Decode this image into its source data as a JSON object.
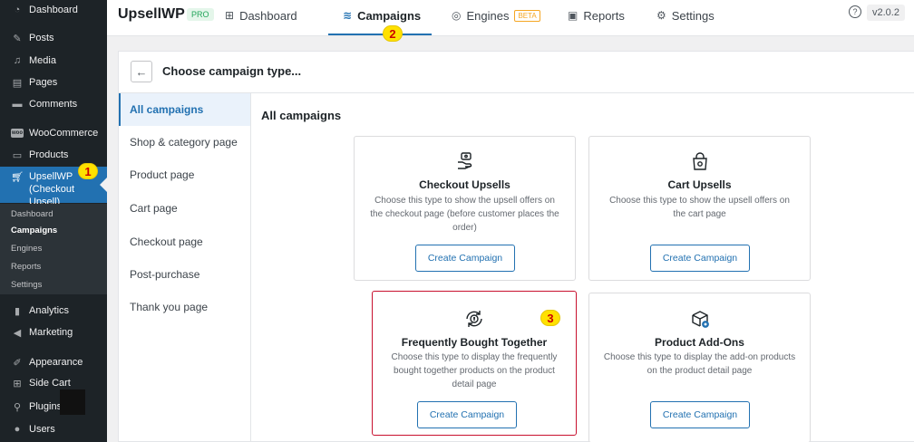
{
  "sidebar": {
    "items": [
      {
        "label": "Dashboard",
        "icon": "dashboard-icon"
      },
      {
        "label": "Posts",
        "icon": "pin-icon"
      },
      {
        "label": "Media",
        "icon": "media-icon"
      },
      {
        "label": "Pages",
        "icon": "page-icon"
      },
      {
        "label": "Comments",
        "icon": "comment-icon"
      },
      {
        "label": "WooCommerce",
        "icon": "woo-icon"
      },
      {
        "label": "Products",
        "icon": "archive-icon"
      },
      {
        "label": "Analytics",
        "icon": "bar-chart-icon"
      },
      {
        "label": "Marketing",
        "icon": "megaphone-icon"
      },
      {
        "label": "Appearance",
        "icon": "brush-icon"
      },
      {
        "label": "Side Cart",
        "icon": "cart-icon"
      },
      {
        "label": "Plugins",
        "icon": "plug-icon"
      },
      {
        "label": "Users",
        "icon": "user-icon"
      }
    ],
    "active": {
      "line1": "UpsellWP",
      "line2": "(Checkout Upsell)"
    },
    "submenu": [
      "Dashboard",
      "Campaigns",
      "Engines",
      "Reports",
      "Settings"
    ],
    "submenu_current": "Campaigns",
    "woo_badge": "woo"
  },
  "badges": {
    "one": "1",
    "two": "2",
    "three": "3"
  },
  "topbar": {
    "brand": "UpsellWP",
    "pro": "PRO",
    "tabs": [
      {
        "label": "Dashboard"
      },
      {
        "label": "Campaigns"
      },
      {
        "label": "Engines",
        "badge": "BETA"
      },
      {
        "label": "Reports"
      },
      {
        "label": "Settings"
      }
    ],
    "help": "?",
    "version": "v2.0.2"
  },
  "panel": {
    "title": "Choose campaign type...",
    "back": "←",
    "section_title": "All campaigns"
  },
  "categories": [
    "All campaigns",
    "Shop & category page",
    "Product page",
    "Cart page",
    "Checkout page",
    "Post-purchase",
    "Thank you page"
  ],
  "cards": [
    {
      "title": "Checkout Upsells",
      "desc": "Choose this type to show the upsell offers on the checkout page (before customer places the order)",
      "button": "Create Campaign",
      "icon": "hand-coin-icon"
    },
    {
      "title": "Cart Upsells",
      "desc": "Choose this type to show the upsell offers on the cart page",
      "button": "Create Campaign",
      "icon": "bag-icon"
    },
    {
      "title": "Frequently Bought Together",
      "desc": "Choose this type to display the frequently bought together products on the product detail page",
      "button": "Create Campaign",
      "icon": "cycle-coin-icon"
    },
    {
      "title": "Product Add-Ons",
      "desc": "Choose this type to display the add-on products on the product detail page",
      "button": "Create Campaign",
      "icon": "box-plus-icon"
    }
  ],
  "colors": {
    "accent": "#2271b1",
    "highlight_border": "#c8102e",
    "badge": "#ffe100"
  }
}
